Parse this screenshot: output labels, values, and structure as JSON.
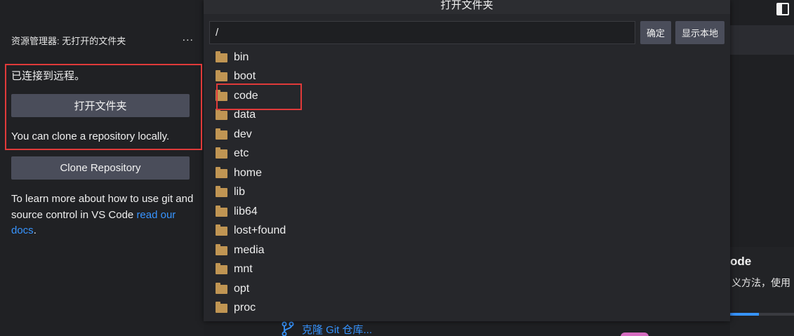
{
  "sidebar": {
    "title": "资源管理器: 无打开的文件夹",
    "more_icon": "...",
    "connected_text": "已连接到远程。",
    "open_folder_label": "打开文件夹",
    "clone_hint": "You can clone a repository locally.",
    "clone_repo_label": "Clone Repository",
    "learn_more_prefix": "To learn more about how to use git and source control in VS Code ",
    "learn_more_link": "read our docs",
    "learn_more_suffix": "."
  },
  "dialog": {
    "title": "打开文件夹",
    "path_value": "/",
    "ok_label": "确定",
    "show_local_label": "显示本地",
    "folders": [
      "bin",
      "boot",
      "code",
      "data",
      "dev",
      "etc",
      "home",
      "lib",
      "lib64",
      "lost+found",
      "media",
      "mnt",
      "opt",
      "proc"
    ]
  },
  "background": {
    "card_title": "ode",
    "card_desc": "义方法，使用",
    "card_progress": 0.45,
    "clone_git_label": "克隆 Git 仓库..."
  },
  "icons": {
    "more": "more-icon",
    "folder": "folder-icon",
    "branch": "git-branch-icon",
    "layout": "toggle-sidebar-icon"
  },
  "colors": {
    "accent": "#3794ff",
    "folder": "#c09553",
    "annotation": "#e03a3a",
    "button": "#4a4d5a"
  }
}
